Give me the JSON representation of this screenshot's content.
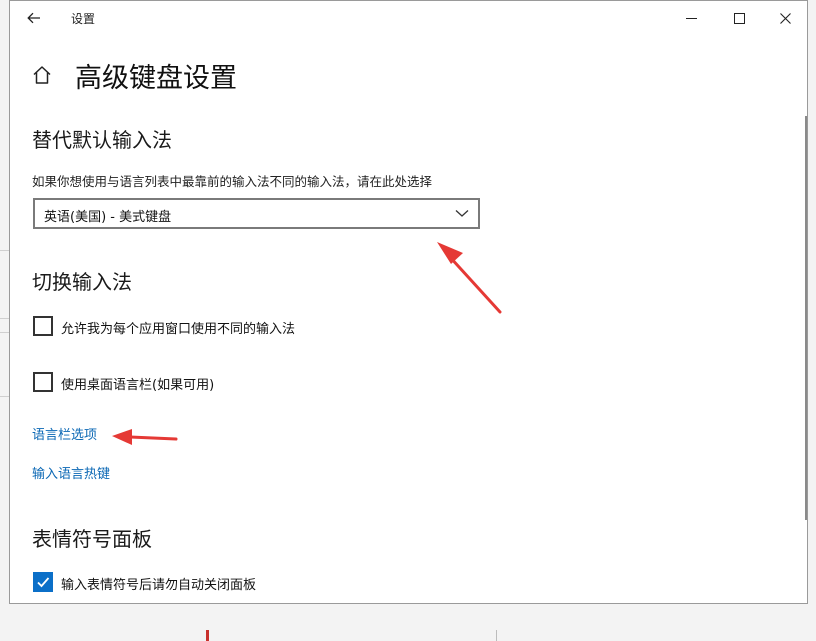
{
  "window": {
    "title": "设置",
    "page_title": "高级键盘设置"
  },
  "override_section": {
    "heading": "替代默认输入法",
    "description": "如果你想使用与语言列表中最靠前的输入法不同的输入法，请在此处选择",
    "selected_input_method": "英语(美国) - 美式键盘"
  },
  "switch_section": {
    "heading": "切换输入法",
    "options": [
      {
        "label": "允许我为每个应用窗口使用不同的输入法",
        "checked": false
      },
      {
        "label": "使用桌面语言栏(如果可用)",
        "checked": false
      }
    ],
    "links": [
      {
        "label": "语言栏选项"
      },
      {
        "label": "输入语言热键"
      }
    ]
  },
  "emoji_section": {
    "heading": "表情符号面板",
    "options": [
      {
        "label": "输入表情符号后请勿自动关闭面板",
        "checked": true
      }
    ]
  },
  "icons": {
    "back": "back-arrow-icon",
    "minimize": "minimize-icon",
    "maximize": "maximize-icon",
    "close": "close-icon",
    "home": "home-icon",
    "dropdown": "chevron-down-icon",
    "check": "checkmark-icon"
  },
  "colors": {
    "accent": "#0b6fc8",
    "link": "#0a67b4",
    "annotation_arrow": "#e53935"
  }
}
